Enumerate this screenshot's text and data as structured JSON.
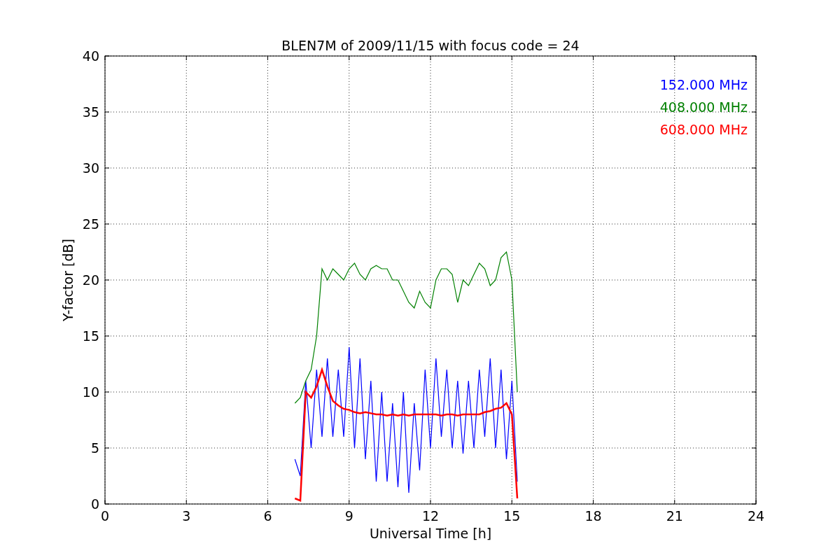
{
  "chart_data": {
    "type": "line",
    "title": "BLEN7M of 2009/11/15 with focus code = 24",
    "xlabel": "Universal Time [h]",
    "ylabel": "Y-factor [dB]",
    "xlim": [
      0,
      24
    ],
    "ylim": [
      0,
      40
    ],
    "xticks": [
      0,
      3,
      6,
      9,
      12,
      15,
      18,
      21,
      24
    ],
    "yticks": [
      0,
      5,
      10,
      15,
      20,
      25,
      30,
      35,
      40
    ],
    "grid": true,
    "x": [
      7.0,
      7.2,
      7.4,
      7.6,
      7.8,
      8.0,
      8.2,
      8.4,
      8.6,
      8.8,
      9.0,
      9.2,
      9.4,
      9.6,
      9.8,
      10.0,
      10.2,
      10.4,
      10.6,
      10.8,
      11.0,
      11.2,
      11.4,
      11.6,
      11.8,
      12.0,
      12.2,
      12.4,
      12.6,
      12.8,
      13.0,
      13.2,
      13.4,
      13.6,
      13.8,
      14.0,
      14.2,
      14.4,
      14.6,
      14.8,
      15.0,
      15.2
    ],
    "series": [
      {
        "name": "152.000 MHz",
        "color": "#0000ff",
        "values": [
          4,
          2.5,
          11,
          5,
          12,
          6,
          13,
          6,
          12,
          6,
          14,
          5,
          13,
          4,
          11,
          2,
          10,
          2,
          9,
          1.5,
          10,
          1,
          9,
          3,
          12,
          5,
          13,
          6,
          12,
          5,
          11,
          4.5,
          11,
          5,
          12,
          6,
          13,
          5,
          12,
          4,
          11,
          2
        ]
      },
      {
        "name": "408.000 MHz",
        "color": "#008000",
        "values": [
          9,
          9.5,
          11,
          12,
          15,
          21,
          20,
          21,
          20.5,
          20,
          21,
          21.5,
          20.5,
          20,
          21,
          21.3,
          21,
          21,
          20,
          20,
          19,
          18,
          17.5,
          19,
          18,
          17.5,
          20,
          21,
          21,
          20.5,
          18,
          20,
          19.5,
          20.5,
          21.5,
          21,
          19.5,
          20,
          22,
          22.5,
          20,
          10
        ]
      },
      {
        "name": "608.000 MHz",
        "color": "#ff0000",
        "values": [
          0.5,
          0.3,
          10,
          9.5,
          10.5,
          12,
          10.5,
          9.2,
          8.8,
          8.5,
          8.4,
          8.2,
          8.1,
          8.2,
          8.1,
          8,
          8,
          7.9,
          8,
          7.9,
          8,
          7.9,
          8,
          8,
          8,
          8,
          8,
          7.9,
          8,
          8,
          7.9,
          8,
          8,
          8,
          8,
          8.2,
          8.3,
          8.5,
          8.6,
          9,
          8,
          0.5
        ]
      }
    ]
  }
}
